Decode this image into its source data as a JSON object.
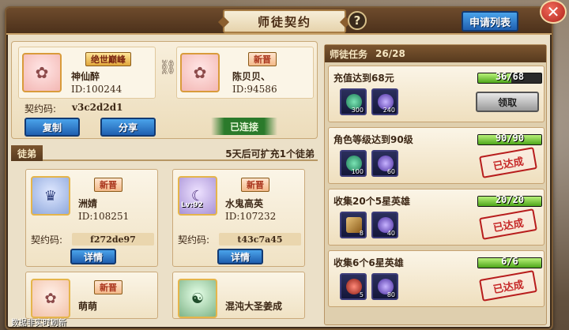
{
  "window": {
    "title": "师徒契约",
    "help_label": "?",
    "apply_list_label": "申请列表",
    "close_label": "✕"
  },
  "master": {
    "left": {
      "badge": "绝世巅峰",
      "name": "神仙醉",
      "id": "ID:100244"
    },
    "right": {
      "badge": "新晋",
      "name": "陈贝贝、",
      "id": "ID:94586"
    },
    "contract_label": "契约码:",
    "contract_code": "v3c2d2d1",
    "copy_label": "复制",
    "share_label": "分享",
    "status": "已连接"
  },
  "apprentices": {
    "tab_label": "徒弟",
    "note": "5天后可扩充1个徒弟",
    "list": [
      {
        "badge": "新晋",
        "name": "洲婧",
        "id": "ID:108251",
        "code_label": "契约码:",
        "code": "f272de97",
        "detail": "详情",
        "level": ""
      },
      {
        "badge": "新晋",
        "name": "水鬼高英",
        "id": "ID:107232",
        "code_label": "契约码:",
        "code": "t43c7a45",
        "detail": "详情",
        "level": "Lv:92"
      },
      {
        "badge": "新晋",
        "name": "萌萌"
      },
      {
        "name": "混沌大圣姜成"
      }
    ],
    "footer": "数据非实时刷新"
  },
  "tasks": {
    "header": "师徒任务",
    "count": "26/28",
    "items": [
      {
        "title": "充值达到68元",
        "progress_text": "36/68",
        "progress": 0.53,
        "rewards": [
          {
            "icon": "jade-coin-icon",
            "qty": "300"
          },
          {
            "icon": "purple-orb-icon",
            "qty": "240"
          }
        ],
        "state": "claim",
        "claim_label": "领取"
      },
      {
        "title": "角色等级达到90级",
        "progress_text": "90/90",
        "progress": 1.0,
        "rewards": [
          {
            "icon": "jade-coin-icon",
            "qty": "100"
          },
          {
            "icon": "purple-orb-icon",
            "qty": "60"
          }
        ],
        "state": "done",
        "done_label": "已达成"
      },
      {
        "title": "收集20个5星英雄",
        "progress_text": "20/20",
        "progress": 1.0,
        "rewards": [
          {
            "icon": "scroll-icon",
            "qty": "8"
          },
          {
            "icon": "purple-orb-icon",
            "qty": "40"
          }
        ],
        "state": "done",
        "done_label": "已达成"
      },
      {
        "title": "收集6个6星英雄",
        "progress_text": "6/6",
        "progress": 1.0,
        "rewards": [
          {
            "icon": "red-gem-icon",
            "qty": "5"
          },
          {
            "icon": "purple-orb-icon",
            "qty": "80"
          }
        ],
        "state": "done",
        "done_label": "已达成"
      }
    ]
  },
  "colors": {
    "accent_blue": "#1f5fb0",
    "progress_green": "#4ea61a",
    "stamp_red": "#c62828",
    "frame_brown": "#7a5a35"
  }
}
